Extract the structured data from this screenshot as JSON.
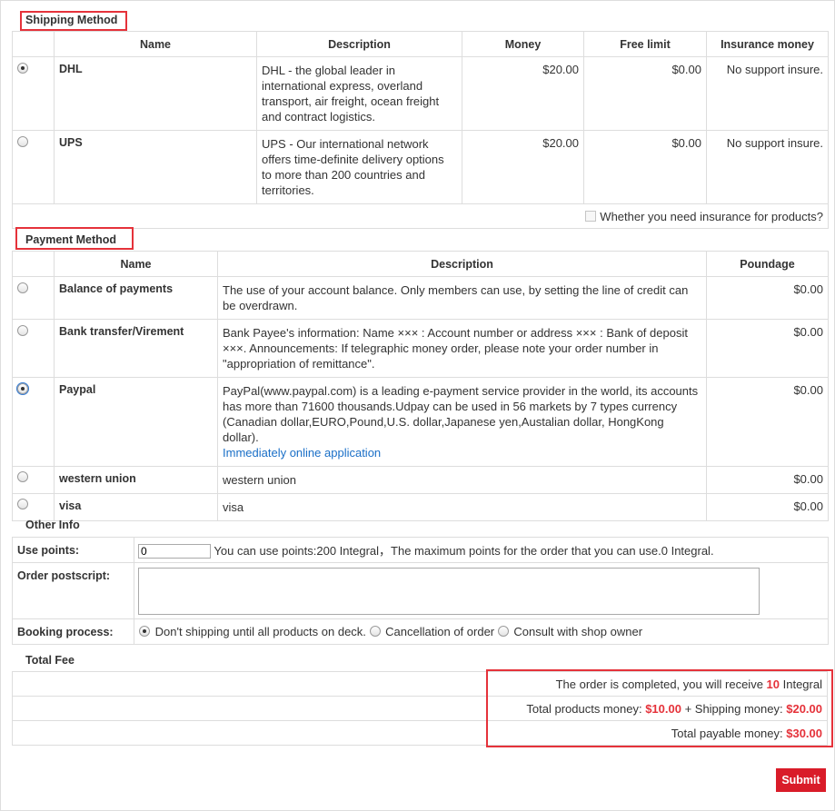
{
  "shipping": {
    "title": "Shipping Method",
    "headers": {
      "name": "Name",
      "description": "Description",
      "money": "Money",
      "free_limit": "Free limit",
      "insurance": "Insurance money"
    },
    "rows": [
      {
        "name": "DHL",
        "description": "DHL - the global leader in international express, overland transport, air freight, ocean freight and contract logistics.",
        "money": "$20.00",
        "free_limit": "$0.00",
        "insurance": "No support insure.",
        "selected": true
      },
      {
        "name": "UPS",
        "description": "UPS - Our international network offers time-definite delivery options to more than 200 countries and territories.",
        "money": "$20.00",
        "free_limit": "$0.00",
        "insurance": "No support insure.",
        "selected": false
      }
    ],
    "insurance_checkbox_label": "Whether you need insurance for products?"
  },
  "payment": {
    "title": "Payment Method",
    "headers": {
      "name": "Name",
      "description": "Description",
      "poundage": "Poundage"
    },
    "rows": [
      {
        "name": "Balance of payments",
        "description": "The use of your account balance. Only members can use, by setting the line of credit can be overdrawn.",
        "poundage": "$0.00"
      },
      {
        "name": "Bank transfer/Virement",
        "description": "Bank Payee's information: Name ××× : Account number or address ××× : Bank of deposit ×××. Announcements: If telegraphic money order, please note your order number in \"appropriation of remittance\".",
        "poundage": "$0.00"
      },
      {
        "name": "Paypal",
        "description": "PayPal(www.paypal.com) is a leading e-payment service provider in the world, its accounts has more than 71600 thousands.Udpay can be used in 56 markets by 7 types currency (Canadian dollar,EURO,Pound,U.S. dollar,Japanese yen,Austalian dollar, HongKong dollar).",
        "link": "Immediately online application",
        "poundage": "$0.00"
      },
      {
        "name": "western union",
        "description": "western union",
        "poundage": "$0.00"
      },
      {
        "name": "visa",
        "description": "visa",
        "poundage": "$0.00"
      }
    ],
    "selected_index": 2
  },
  "other": {
    "title": "Other Info",
    "use_points_label": "Use points:",
    "points_value": "0",
    "points_note": "You can use points:200 Integral，The maximum points for the order that you can use.0 Integral.",
    "postscript_label": "Order postscript:",
    "booking_label": "Booking process:",
    "booking_options": [
      "Don't shipping until all products on deck.",
      "Cancellation of order",
      "Consult with shop owner"
    ],
    "booking_selected": 0
  },
  "total": {
    "title": "Total Fee",
    "line1_pre": "The order is completed, you will receive ",
    "line1_value": "10",
    "line1_post": " Integral",
    "products_label": "Total products money: ",
    "products_value": "$10.00",
    "shipping_label": " + Shipping money: ",
    "shipping_value": "$20.00",
    "payable_label": "Total payable money: ",
    "payable_value": "$30.00"
  },
  "submit_label": "Submit",
  "colors": {
    "highlight": "#e5323a",
    "accent_red": "#d91c29",
    "link": "#1a6fc7"
  }
}
